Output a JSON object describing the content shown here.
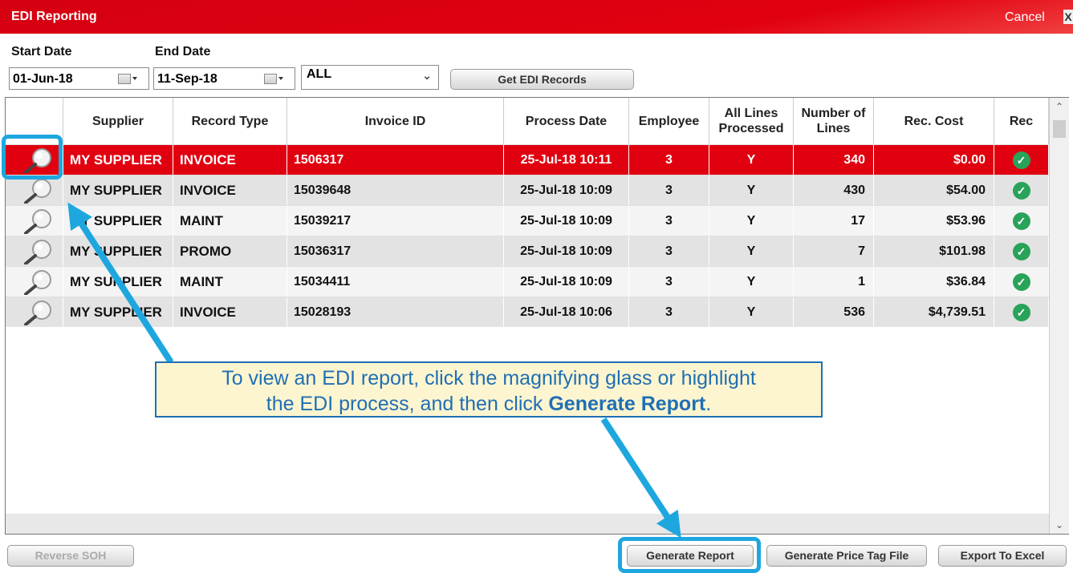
{
  "window": {
    "title": "EDI Reporting",
    "cancel_label": "Cancel",
    "close_glyph": "X"
  },
  "filters": {
    "start_label": "Start Date",
    "end_label": "End Date",
    "start_value": "01-Jun-18",
    "end_value": "11-Sep-18",
    "type_value": "ALL",
    "get_records_label": "Get EDI Records"
  },
  "table": {
    "headers": [
      "Supplier",
      "Record Type",
      "Invoice ID",
      "Process Date",
      "Employee",
      "All Lines Processed",
      "Number of Lines",
      "Rec. Cost",
      "Rec"
    ],
    "rows": [
      {
        "supplier": "MY SUPPLIER",
        "type": "INVOICE",
        "invoice": "1506317",
        "date": "25-Jul-18  10:11",
        "employee": "3",
        "processed": "Y",
        "lines": "340",
        "cost": "$0.00",
        "rec": "check",
        "selected": true
      },
      {
        "supplier": "MY SUPPLIER",
        "type": "INVOICE",
        "invoice": "15039648",
        "date": "25-Jul-18  10:09",
        "employee": "3",
        "processed": "Y",
        "lines": "430",
        "cost": "$54.00",
        "rec": "check",
        "selected": false
      },
      {
        "supplier": "MY SUPPLIER",
        "type": "MAINT",
        "invoice": "15039217",
        "date": "25-Jul-18  10:09",
        "employee": "3",
        "processed": "Y",
        "lines": "17",
        "cost": "$53.96",
        "rec": "check",
        "selected": false
      },
      {
        "supplier": "MY SUPPLIER",
        "type": "PROMO",
        "invoice": "15036317",
        "date": "25-Jul-18  10:09",
        "employee": "3",
        "processed": "Y",
        "lines": "7",
        "cost": "$101.98",
        "rec": "check",
        "selected": false
      },
      {
        "supplier": "MY SUPPLIER",
        "type": "MAINT",
        "invoice": "15034411",
        "date": "25-Jul-18  10:09",
        "employee": "3",
        "processed": "Y",
        "lines": "1",
        "cost": "$36.84",
        "rec": "check",
        "selected": false
      },
      {
        "supplier": "MY SUPPLIER",
        "type": "INVOICE",
        "invoice": "15028193",
        "date": "25-Jul-18  10:06",
        "employee": "3",
        "processed": "Y",
        "lines": "536",
        "cost": "$4,739.51",
        "rec": "check",
        "selected": false
      }
    ]
  },
  "footer": {
    "reverse_soh_label": "Reverse SOH",
    "generate_report_label": "Generate Report",
    "price_tag_label": "Generate Price Tag File",
    "export_label": "Export To Excel"
  },
  "callout": {
    "line1": "To view an EDI report, click the magnifying glass or highlight",
    "line2_prefix": "the EDI process, and then click ",
    "line2_bold": "Generate Report",
    "line2_suffix": "."
  },
  "colors": {
    "brand_red": "#e1000f",
    "highlight_blue": "#1ea7df",
    "callout_text": "#1f6fb5",
    "rec_green": "#29a35a",
    "row_alt": "#e3e3e3"
  },
  "icons": {
    "view": "magnifying-glass-icon",
    "rec": "check-circle-icon",
    "calendar": "calendar-icon"
  }
}
